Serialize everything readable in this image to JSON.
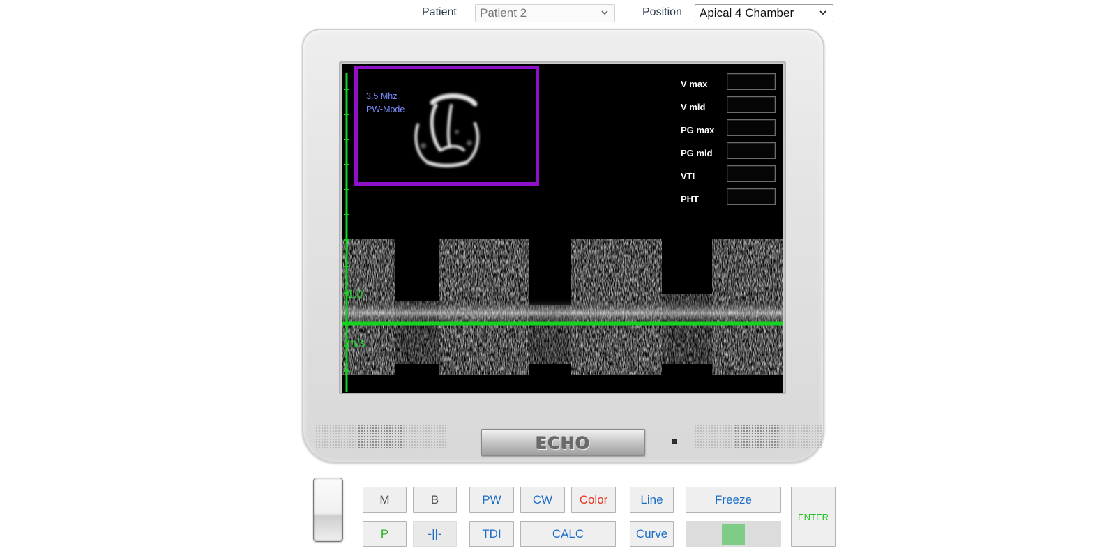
{
  "header": {
    "patient_label": "Patient",
    "patient_value": "Patient 2",
    "position_label": "Position",
    "position_value": "Apical 4 Chamber"
  },
  "screen": {
    "frequency": "3.5 Mhz",
    "mode": "PW-Mode",
    "scale_value": "1.0",
    "scale_unit": "m/s",
    "measurements": [
      {
        "label": "V max",
        "value": ""
      },
      {
        "label": "V mid",
        "value": ""
      },
      {
        "label": "PG max",
        "value": ""
      },
      {
        "label": "PG mid",
        "value": ""
      },
      {
        "label": "VTI",
        "value": ""
      },
      {
        "label": "PHT",
        "value": ""
      }
    ]
  },
  "device": {
    "logo_text": "ECHO"
  },
  "controls": {
    "m": "M",
    "b": "B",
    "p": "P",
    "split": "-||-",
    "pw": "PW",
    "cw": "CW",
    "color": "Color",
    "tdi": "TDI",
    "calc": "CALC",
    "line": "Line",
    "curve": "Curve",
    "freeze": "Freeze",
    "enter": "ENTER"
  },
  "colors": {
    "scale_green": "#1bd12b",
    "preview_border": "#8e10c8",
    "mode_text": "#7b8cff",
    "button_blue": "#1e6ec8",
    "color_button": "#e8361e",
    "slider_thumb": "#7fcc86"
  }
}
